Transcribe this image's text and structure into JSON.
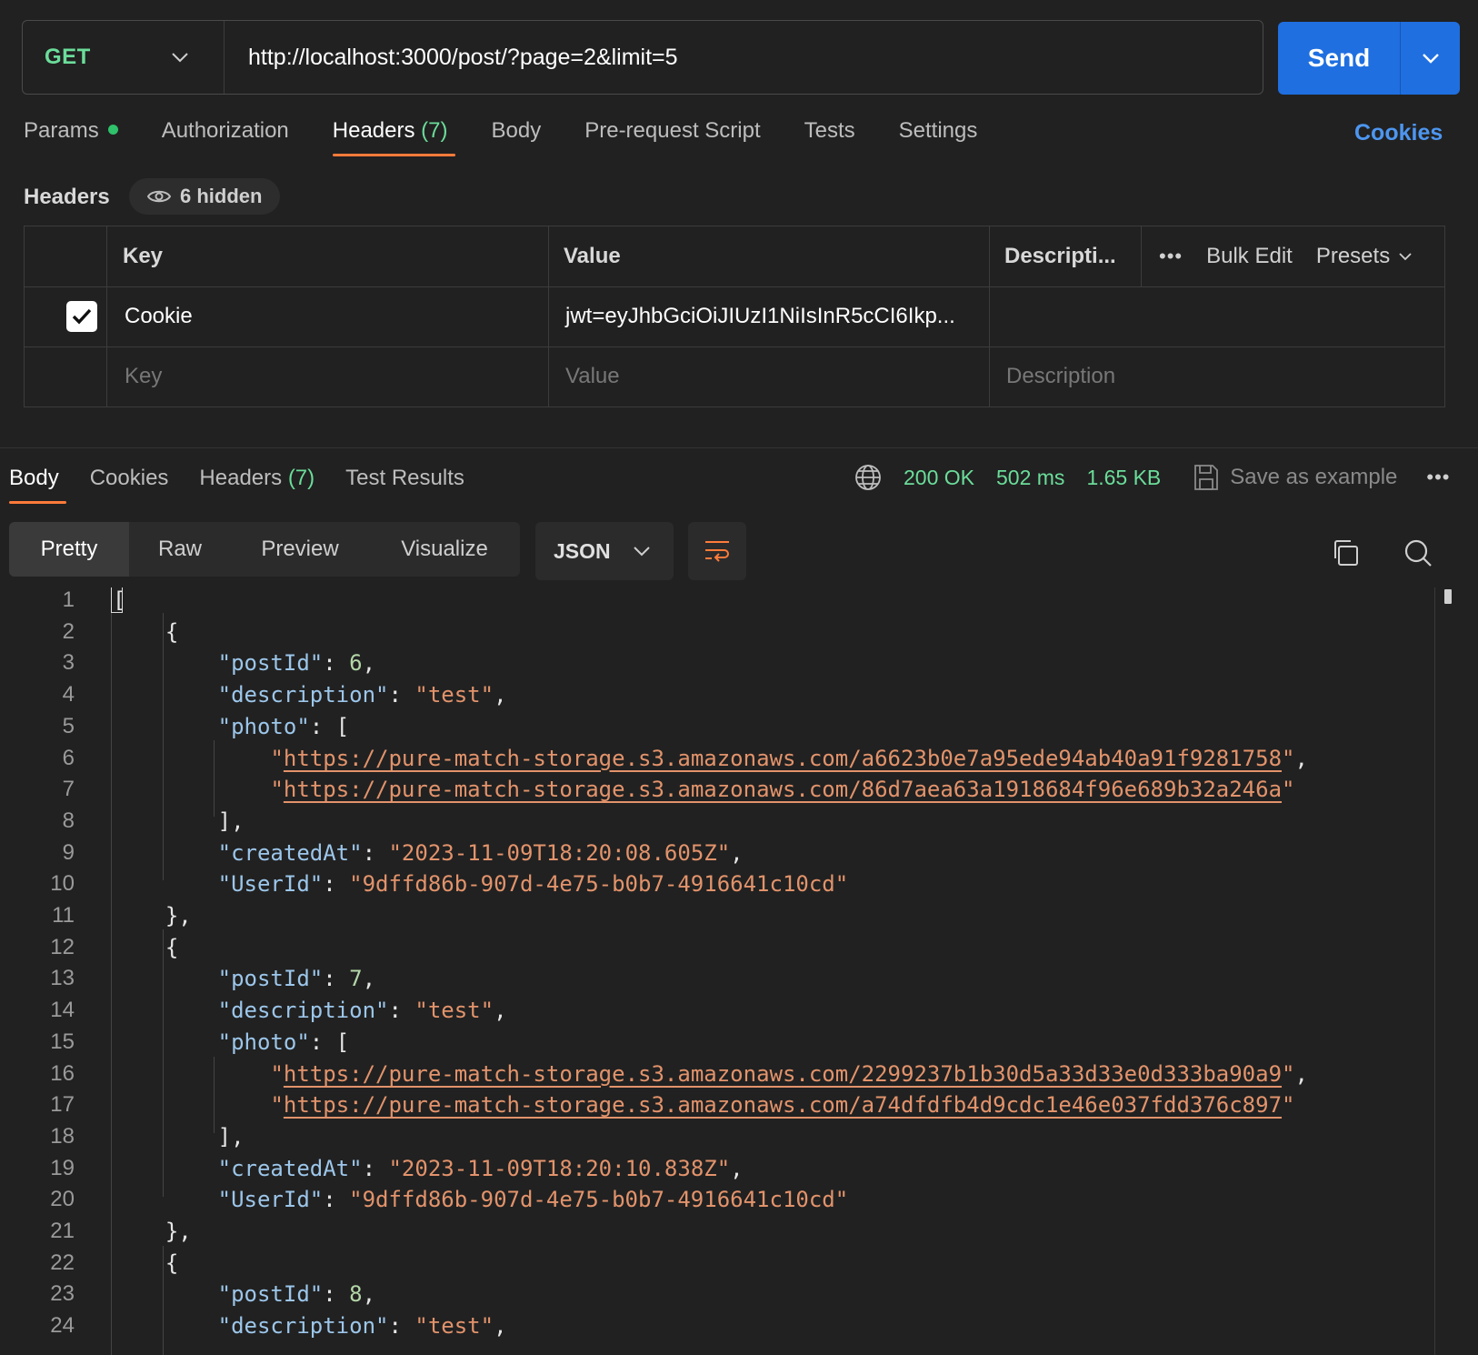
{
  "request": {
    "method": "GET",
    "url": "http://localhost:3000/post/?page=2&limit=5",
    "send_label": "Send"
  },
  "request_tabs": [
    {
      "label": "Params",
      "count": ""
    },
    {
      "label": "Authorization",
      "count": ""
    },
    {
      "label": "Headers",
      "count": "(7)"
    },
    {
      "label": "Body",
      "count": ""
    },
    {
      "label": "Pre-request Script",
      "count": ""
    },
    {
      "label": "Tests",
      "count": ""
    },
    {
      "label": "Settings",
      "count": ""
    }
  ],
  "cookies_link": "Cookies",
  "headers_section": {
    "title": "Headers",
    "hidden_label": "6 hidden",
    "columns": {
      "key": "Key",
      "value": "Value",
      "description": "Descripti..."
    },
    "bulk_edit": "Bulk Edit",
    "presets": "Presets",
    "rows": [
      {
        "key": "Cookie",
        "value": "jwt=eyJhbGciOiJIUzI1NiIsInR5cCI6Ikp..."
      }
    ],
    "placeholders": {
      "key": "Key",
      "value": "Value",
      "description": "Description"
    }
  },
  "response_tabs": [
    {
      "label": "Body",
      "count": ""
    },
    {
      "label": "Cookies",
      "count": ""
    },
    {
      "label": "Headers",
      "count": "(7)"
    },
    {
      "label": "Test Results",
      "count": ""
    }
  ],
  "response_meta": {
    "status": "200 OK",
    "time": "502 ms",
    "size": "1.65 KB",
    "save_example": "Save as example"
  },
  "format": {
    "views": [
      "Pretty",
      "Raw",
      "Preview",
      "Visualize"
    ],
    "language": "JSON"
  },
  "code_lines": [
    "[",
    "    {",
    "        \"postId\": 6,",
    "        \"description\": \"test\",",
    "        \"photo\": [",
    "            \"https://pure-match-storage.s3.amazonaws.com/a6623b0e7a95ede94ab40a91f9281758\",",
    "            \"https://pure-match-storage.s3.amazonaws.com/86d7aea63a1918684f96e689b32a246a\"",
    "        ],",
    "        \"createdAt\": \"2023-11-09T18:20:08.605Z\",",
    "        \"UserId\": \"9dffd86b-907d-4e75-b0b7-4916641c10cd\"",
    "    },",
    "    {",
    "        \"postId\": 7,",
    "        \"description\": \"test\",",
    "        \"photo\": [",
    "            \"https://pure-match-storage.s3.amazonaws.com/2299237b1b30d5a33d33e0d333ba90a9\",",
    "            \"https://pure-match-storage.s3.amazonaws.com/a74dfdfb4d9cdc1e46e037fdd376c897\"",
    "        ],",
    "        \"createdAt\": \"2023-11-09T18:20:10.838Z\",",
    "        \"UserId\": \"9dffd86b-907d-4e75-b0b7-4916641c10cd\"",
    "    },",
    "    {",
    "        \"postId\": 8,",
    "        \"description\": \"test\","
  ],
  "colors": {
    "accent": "#ff7b3a",
    "send": "#1f6fe0",
    "method": "#6bdd9a",
    "link": "#4d96f0"
  }
}
